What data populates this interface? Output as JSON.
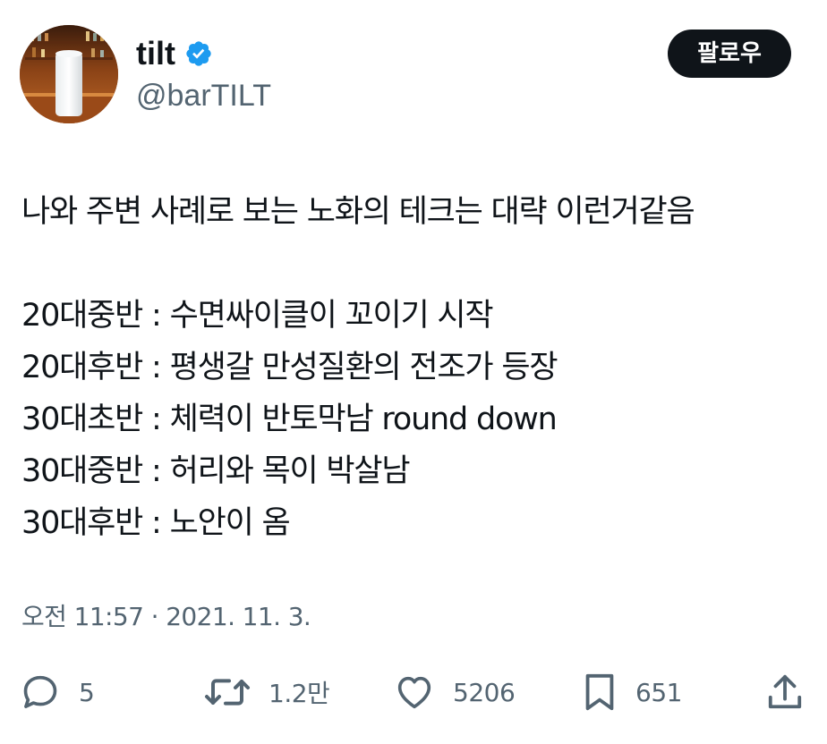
{
  "author": {
    "display_name": "tilt",
    "handle": "@barTILT",
    "verified": true
  },
  "follow_button": {
    "label": "팔로우"
  },
  "tweet": {
    "lines": [
      "나와 주변 사례로 보는 노화의 테크는 대략 이런거같음",
      "",
      "20대중반 : 수면싸이클이 꼬이기 시작",
      "20대후반 : 평생갈 만성질환의 전조가 등장",
      "30대초반 : 체력이 반토막남 round down",
      "30대중반 : 허리와 목이 박살남",
      "30대후반 : 노안이 옴"
    ]
  },
  "timestamp": "오전 11:57 · 2021. 11. 3.",
  "actions": {
    "reply": {
      "icon": "reply-icon",
      "count": "5"
    },
    "retweet": {
      "icon": "retweet-icon",
      "count": "1.2만"
    },
    "like": {
      "icon": "heart-icon",
      "count": "5206"
    },
    "bookmark": {
      "icon": "bookmark-icon",
      "count": "651"
    },
    "share": {
      "icon": "share-icon"
    }
  },
  "colors": {
    "text_primary": "#0f1419",
    "text_secondary": "#536471",
    "verified_blue": "#1d9bf0",
    "button_bg": "#0f1419",
    "button_text": "#ffffff"
  }
}
